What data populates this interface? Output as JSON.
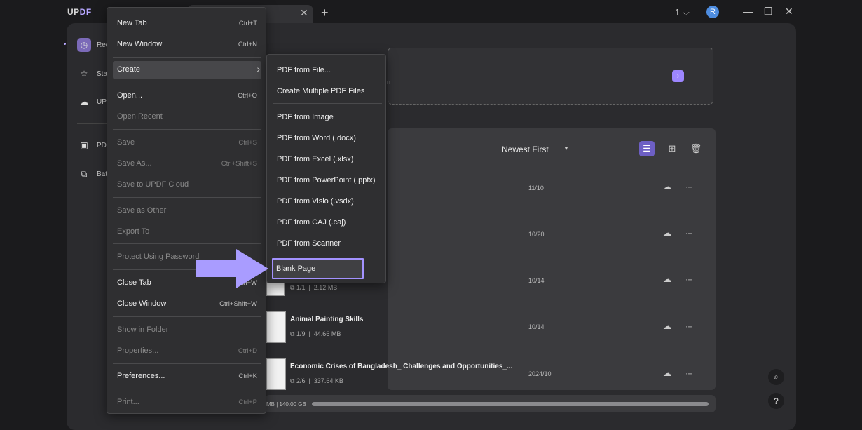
{
  "titlebar": {
    "logo_up": "UP",
    "logo_df": "DF",
    "close_tab": "✕",
    "new_tab": "+",
    "window_count": "1",
    "avatar_letter": "R"
  },
  "sidebar": {
    "items": [
      {
        "label": "Rece",
        "icon": "clock-icon"
      },
      {
        "label": "Star",
        "icon": "star-icon"
      },
      {
        "label": "UPD",
        "icon": "cloud-icon"
      },
      {
        "label": "PDF",
        "icon": "toolbox-icon"
      },
      {
        "label": "Batc",
        "icon": "batch-icon"
      }
    ]
  },
  "dropzone": {
    "hint": "n",
    "button": "›"
  },
  "files": {
    "sort_label": "Newest First",
    "rows": [
      {
        "name": "",
        "pages": "",
        "size": "",
        "date": "11/10"
      },
      {
        "name": "",
        "pages": "",
        "size": "",
        "date": "10/20"
      },
      {
        "name": "",
        "pages": "1/1",
        "size": "2.12 MB",
        "date": "10/14"
      },
      {
        "name": "Animal Painting Skills",
        "pages": "1/9",
        "size": "44.66 MB",
        "date": "10/14"
      },
      {
        "name": "Economic Crises of Bangladesh_ Challenges and Opportunities_...",
        "pages": "2/6",
        "size": "337.64 KB",
        "date": "2024/10"
      }
    ]
  },
  "storage": {
    "text": "MB | 140.00 GB"
  },
  "file_menu": {
    "items": [
      {
        "label": "New Tab",
        "shortcut": "Ctrl+T",
        "disabled": false
      },
      {
        "label": "New Window",
        "shortcut": "Ctrl+N",
        "disabled": false
      },
      {
        "label": "Create",
        "shortcut": "",
        "disabled": false
      },
      {
        "label": "Open...",
        "shortcut": "Ctrl+O",
        "disabled": false
      },
      {
        "label": "Open Recent",
        "shortcut": "",
        "disabled": true
      },
      {
        "label": "Save",
        "shortcut": "Ctrl+S",
        "disabled": true
      },
      {
        "label": "Save As...",
        "shortcut": "Ctrl+Shift+S",
        "disabled": true
      },
      {
        "label": "Save to UPDF Cloud",
        "shortcut": "",
        "disabled": true
      },
      {
        "label": "Save as Other",
        "shortcut": "",
        "disabled": true
      },
      {
        "label": "Export To",
        "shortcut": "",
        "disabled": true
      },
      {
        "label": "Protect Using Password",
        "shortcut": "",
        "disabled": true
      },
      {
        "label": "Close Tab",
        "shortcut": "Ctrl+W",
        "disabled": false
      },
      {
        "label": "Close Window",
        "shortcut": "Ctrl+Shift+W",
        "disabled": false
      },
      {
        "label": "Show in Folder",
        "shortcut": "",
        "disabled": true
      },
      {
        "label": "Properties...",
        "shortcut": "Ctrl+D",
        "disabled": true
      },
      {
        "label": "Preferences...",
        "shortcut": "Ctrl+K",
        "disabled": false
      },
      {
        "label": "Print...",
        "shortcut": "Ctrl+P",
        "disabled": true
      }
    ]
  },
  "create_submenu": {
    "items": [
      "PDF from File...",
      "Create Multiple PDF Files",
      "PDF from Image",
      "PDF from Word (.docx)",
      "PDF from Excel (.xlsx)",
      "PDF from PowerPoint (.pptx)",
      "PDF from Visio (.vsdx)",
      "PDF from CAJ (.caj)",
      "PDF from Scanner",
      "Blank Page"
    ]
  },
  "colors": {
    "accent": "#a392ff",
    "arrow": "#a99cff",
    "menu_bg": "#2f2f31",
    "app_bg": "#2b2b2e"
  }
}
